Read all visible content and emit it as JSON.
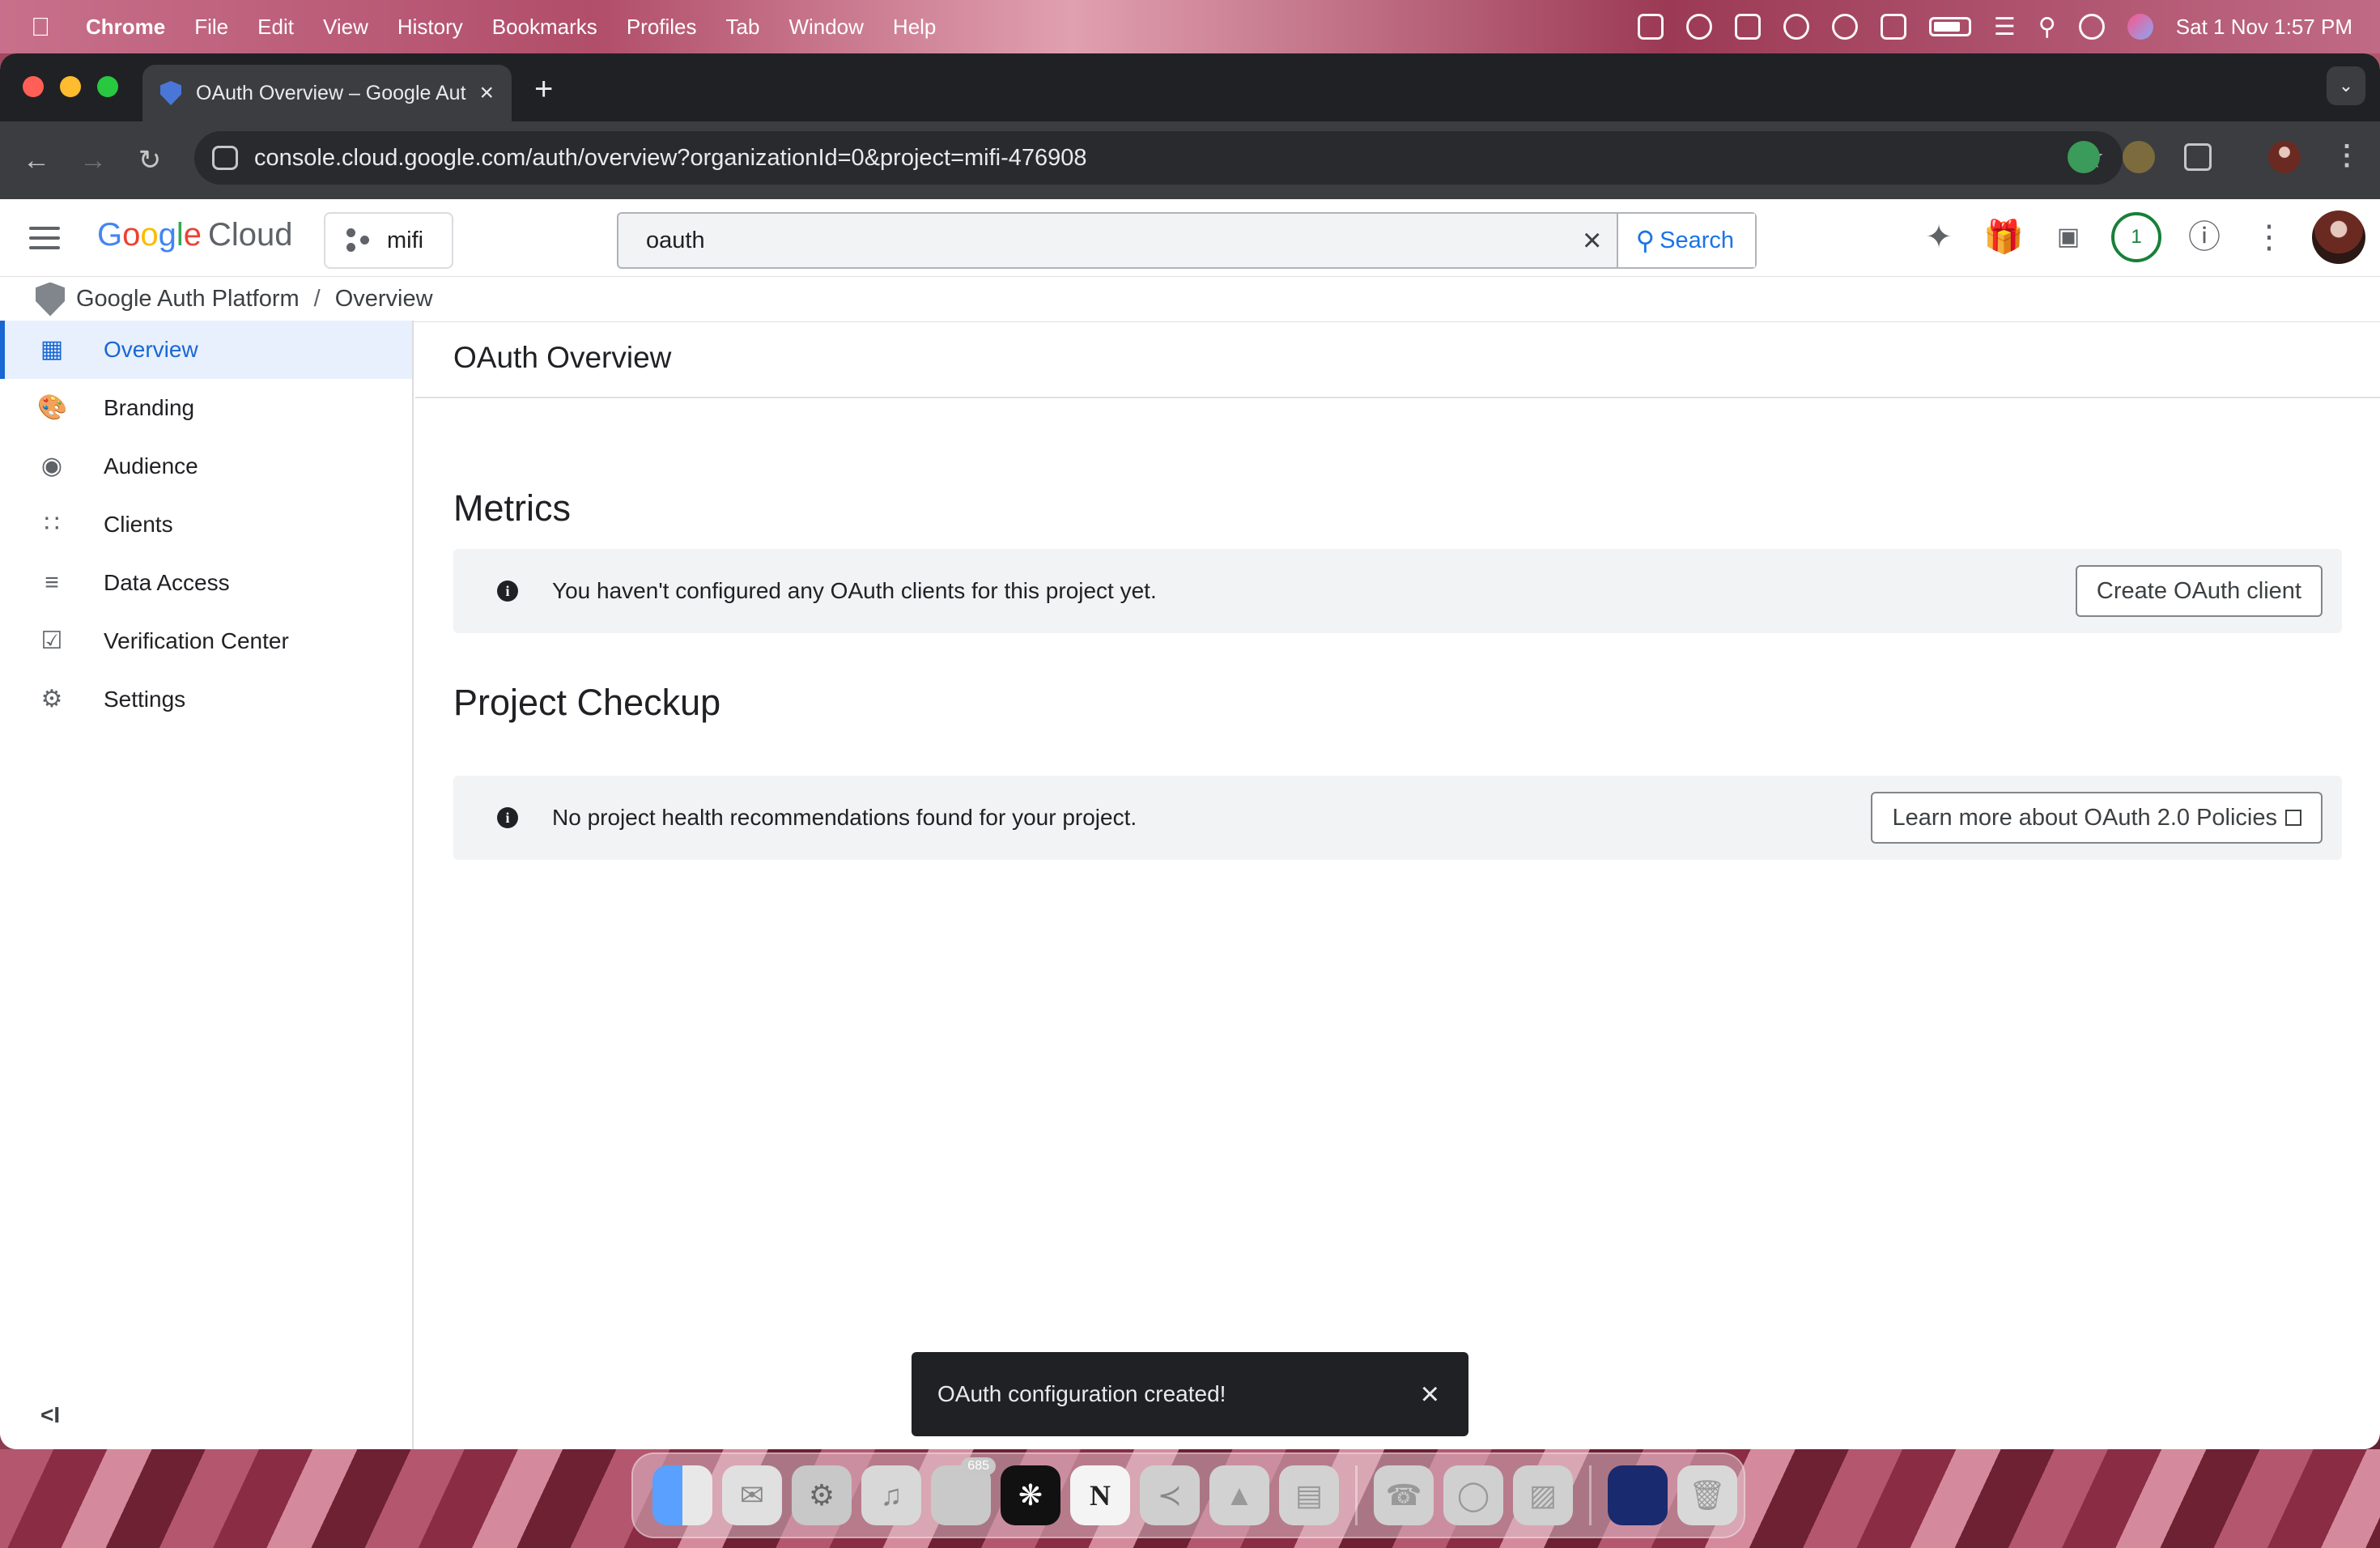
{
  "menubar": {
    "app_name": "Chrome",
    "menus": [
      "File",
      "Edit",
      "View",
      "History",
      "Bookmarks",
      "Profiles",
      "Tab",
      "Window",
      "Help"
    ],
    "clock": "Sat 1 Nov  1:57 PM"
  },
  "browser": {
    "tab_title": "OAuth Overview – Google Aut",
    "url": "console.cloud.google.com/auth/overview?organizationId=0&project=mifi-476908"
  },
  "gcp_header": {
    "logo_google": "Google",
    "logo_cloud": "Cloud",
    "project_name": "mifi",
    "search_value": "oauth",
    "search_button": "Search",
    "notification_count": "1"
  },
  "breadcrumb": {
    "product": "Google Auth Platform",
    "separator": "/",
    "page": "Overview"
  },
  "sidebar": {
    "items": [
      {
        "label": "Overview",
        "icon": "dashboard-icon"
      },
      {
        "label": "Branding",
        "icon": "palette-icon"
      },
      {
        "label": "Audience",
        "icon": "account-circle-icon"
      },
      {
        "label": "Clients",
        "icon": "apps-grid-icon"
      },
      {
        "label": "Data Access",
        "icon": "data-access-icon"
      },
      {
        "label": "Verification Center",
        "icon": "verification-icon"
      },
      {
        "label": "Settings",
        "icon": "gear-icon"
      }
    ],
    "collapse_label": "<I"
  },
  "main": {
    "page_title": "OAuth Overview",
    "metrics": {
      "title": "Metrics",
      "message": "You haven't configured any OAuth clients for this project yet.",
      "button": "Create OAuth client"
    },
    "checkup": {
      "title": "Project Checkup",
      "message": "No project health recommendations found for your project.",
      "button": "Learn more about OAuth 2.0 Policies"
    }
  },
  "toast": {
    "message": "OAuth configuration created!"
  },
  "dock": {
    "discord_badge": "685"
  },
  "colors": {
    "accent": "#1a73e8",
    "active_nav_bg": "#e8f0fe",
    "banner_bg": "#f1f3f4",
    "toast_bg": "#202124",
    "notification_ring": "#188038"
  }
}
